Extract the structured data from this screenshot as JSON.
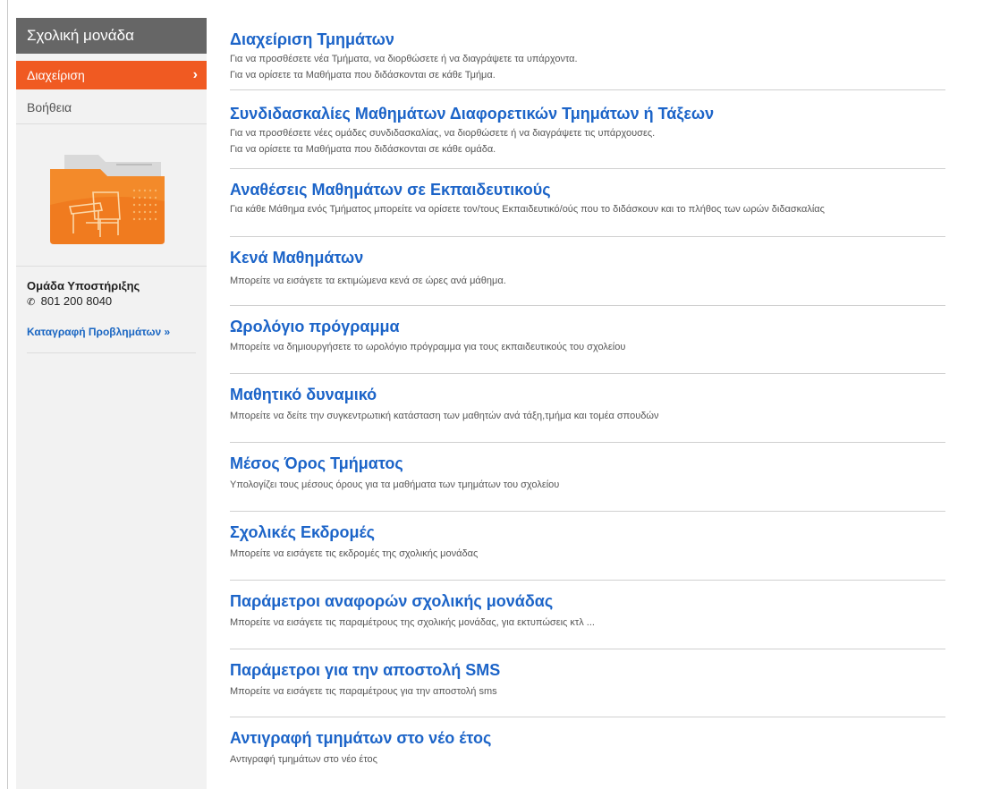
{
  "sidebar": {
    "header": "Σχολική μονάδα",
    "active_item": "Διαχείριση",
    "help": "Βοήθεια",
    "support_title": "Ομάδα Υποστήριξης",
    "support_phone": "801 200 8040",
    "report_link": "Καταγραφή Προβλημάτων »"
  },
  "items": [
    {
      "title": "Διαχείριση Τμημάτων",
      "desc": [
        "Για να προσθέσετε νέα Τμήματα, να διορθώσετε ή να διαγράψετε τα υπάρχοντα.",
        "Για να ορίσετε τα Μαθήματα που διδάσκονται σε κάθε Τμήμα."
      ]
    },
    {
      "title": "Συνδιδασκαλίες Μαθημάτων Διαφορετικών Τμημάτων ή Τάξεων",
      "desc": [
        "Για να προσθέσετε νέες ομάδες συνδιδασκαλίας, να διορθώσετε ή να διαγράψετε τις υπάρχουσες.",
        "Για να ορίσετε τα Μαθήματα που διδάσκονται σε κάθε ομάδα."
      ]
    },
    {
      "title": "Αναθέσεις Μαθημάτων σε Εκπαιδευτικούς",
      "desc": [
        "Για κάθε Μάθημα ενός Τμήματος μπορείτε να ορίσετε τον/τους Εκπαιδευτικό/ούς που το διδάσκουν και το πλήθος των ωρών διδασκαλίας"
      ]
    },
    {
      "title": "Κενά Μαθημάτων",
      "desc": [
        "Μπορείτε να εισάγετε τα εκτιμώμενα κενά σε ώρες ανά μάθημα."
      ]
    },
    {
      "title": "Ωρολόγιο πρόγραμμα",
      "desc": [
        "Μπορείτε να δημιουργήσετε το ωρολόγιο πρόγραμμα για τους εκπαιδευτικούς του σχολείου"
      ]
    },
    {
      "title": "Μαθητικό δυναμικό",
      "desc": [
        "Μπορείτε να δείτε την συγκεντρωτική κατάσταση των μαθητών ανά τάξη,τμήμα και τομέα σπουδών"
      ]
    },
    {
      "title": "Μέσος Όρος Τμήματος",
      "desc": [
        "Υπολογίζει τους μέσους όρους για τα μαθήματα των τμημάτων του σχολείου"
      ]
    },
    {
      "title": "Σχολικές Εκδρομές",
      "desc": [
        "Μπορείτε να εισάγετε τις εκδρομές της σχολικής μονάδας"
      ]
    },
    {
      "title": "Παράμετροι αναφορών σχολικής μονάδας",
      "desc": [
        "Μπορείτε να εισάγετε τις παραμέτρους της σχολικής μονάδας, για εκτυπώσεις κτλ ..."
      ]
    },
    {
      "title": "Παράμετροι για την αποστολή SMS",
      "desc": [
        "Μπορείτε να εισάγετε τις παραμέτρους για την αποστολή sms"
      ]
    },
    {
      "title": "Αντιγραφή τμημάτων στο νέο έτος",
      "desc": [
        "Αντιγραφή τμημάτων στο νέο έτος"
      ]
    }
  ]
}
